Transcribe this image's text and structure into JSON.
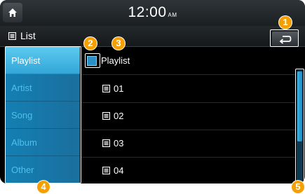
{
  "status_bar": {
    "time": "12:00",
    "ampm": "AM"
  },
  "title_bar": {
    "title": "List"
  },
  "sidebar": {
    "items": [
      {
        "label": "Playlist",
        "active": true
      },
      {
        "label": "Artist",
        "active": false
      },
      {
        "label": "Song",
        "active": false
      },
      {
        "label": "Album",
        "active": false
      },
      {
        "label": "Other",
        "active": false
      }
    ]
  },
  "content": {
    "folder_label": "Playlist",
    "rows": [
      "01",
      "02",
      "03",
      "04"
    ]
  },
  "markers": [
    "1",
    "2",
    "3",
    "4",
    "5"
  ],
  "colors": {
    "accent": "#f5a000",
    "sidebar": "#1a78a8",
    "active_item": "#4dbbe8"
  }
}
